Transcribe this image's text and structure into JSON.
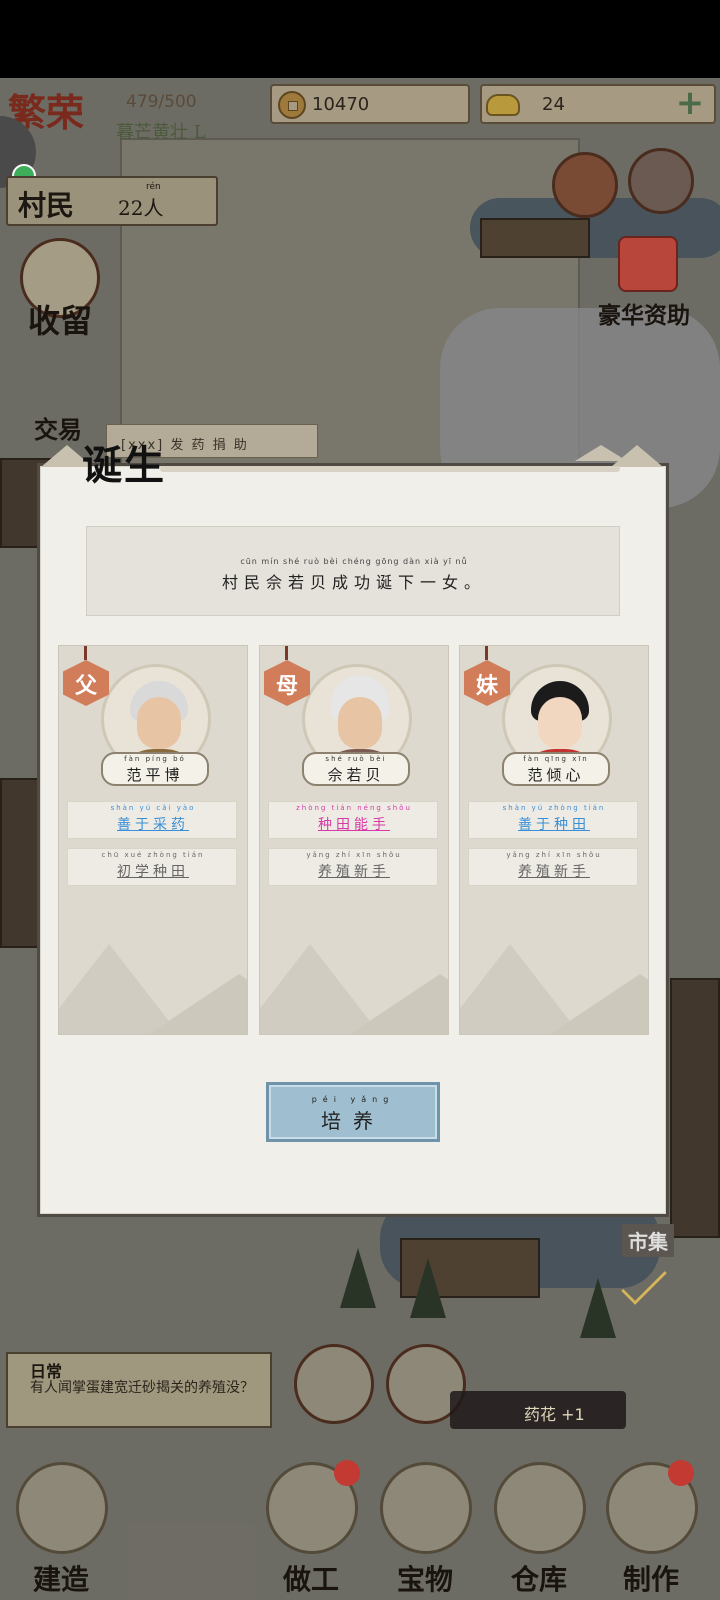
{
  "hud": {
    "prosperity_title": "繁荣",
    "prosperity_count": "479/500",
    "prosperity_sub": "暮芒黄壮 L",
    "copper": "10470",
    "ingot": "24",
    "plus": "+",
    "villagers_label": "村民",
    "villagers_pinyin": "rén",
    "villagers_count": "22人",
    "shelter_label": "收留",
    "trade_label": "交易",
    "luxury_label": "豪华资助",
    "market_label": "市集",
    "banner_text": "[xxx] 发 药 捐 助"
  },
  "dialog": {
    "title": "诞生",
    "message_pinyin": "cūn  mín  shé  ruò  bèi  chéng gōng  dàn  xià  yī  nǚ",
    "message": "村民佘若贝成功诞下一女。",
    "cards": [
      {
        "relation": "父",
        "name_pinyin": "fàn  píng  bó",
        "name": "范平博",
        "trait1_pinyin": "shàn  yú  cǎi  yào",
        "trait1": "善于采药",
        "trait1_color": "#3a8fd6",
        "trait2_pinyin": "chū  xué  zhòng  tián",
        "trait2": "初学种田",
        "trait2_color": "#666666"
      },
      {
        "relation": "母",
        "name_pinyin": "shé  ruò  bèi",
        "name": "佘若贝",
        "trait1_pinyin": "zhòng tián  néng  shǒu",
        "trait1": "种田能手",
        "trait1_color": "#d63aa8",
        "trait2_pinyin": "yǎng  zhí  xīn  shǒu",
        "trait2": "养殖新手",
        "trait2_color": "#666666"
      },
      {
        "relation": "妹",
        "name_pinyin": "fàn  qīng  xīn",
        "name": "范倾心",
        "trait1_pinyin": "shàn  yú  zhòng  tián",
        "trait1": "善于种田",
        "trait1_color": "#3a8fd6",
        "trait2_pinyin": "yǎng  zhí  xīn  shǒu",
        "trait2": "养殖新手",
        "trait2_color": "#666666"
      }
    ],
    "button_pinyin": "péi  yǎng",
    "button": "培养"
  },
  "bottom": {
    "quest_title": "日常",
    "quest_desc": "有人闻掌蛋建宽迁砂揭关的养殖没？",
    "toast": "药花 +1",
    "nav": [
      "建造",
      "做工",
      "宝物",
      "仓库",
      "制作"
    ]
  },
  "colors": {
    "accent_blue": "#9fbfd0",
    "tag_orange": "#d27d5a",
    "panel": "#f1efe9"
  }
}
